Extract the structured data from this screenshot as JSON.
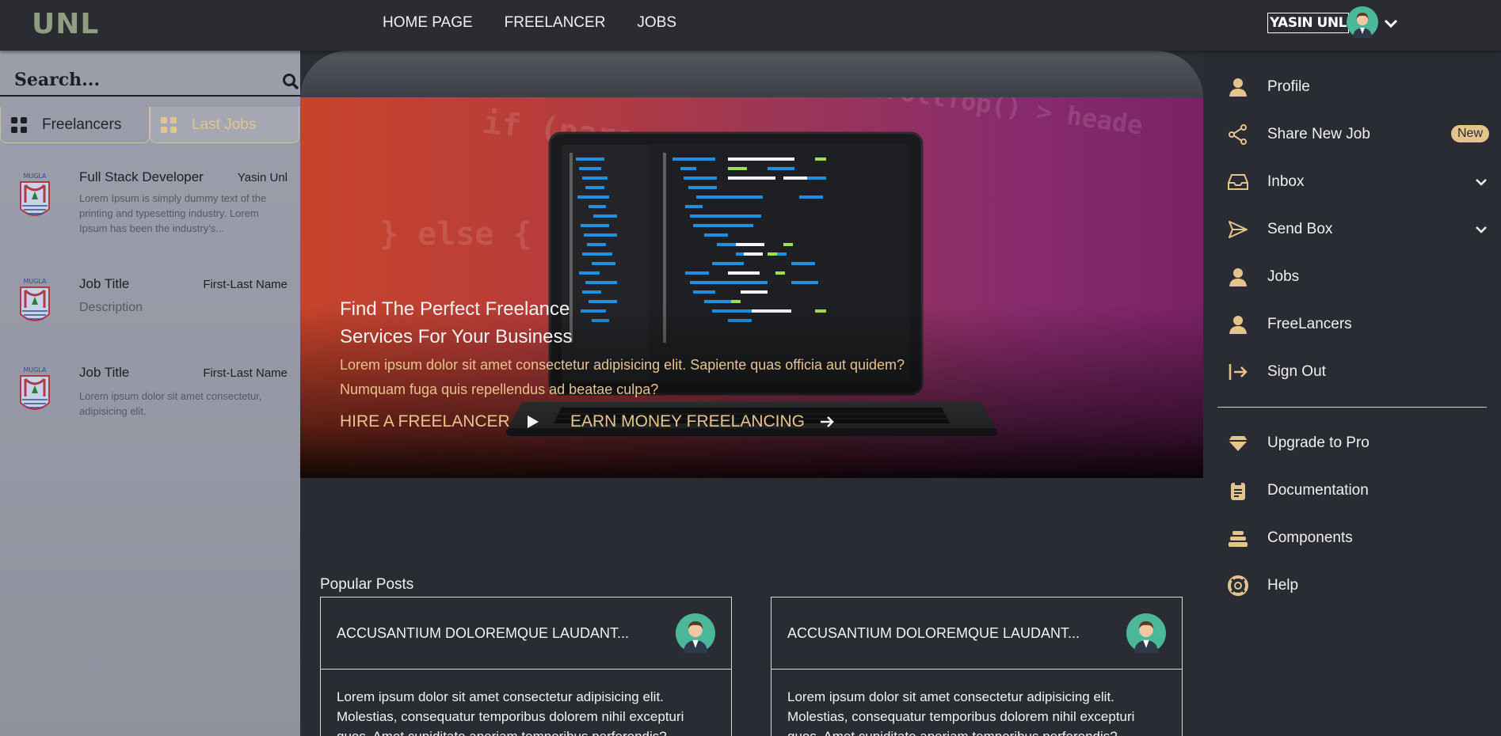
{
  "brand": "UNL",
  "nav": [
    "HOME PAGE",
    "FREELANCER",
    "JOBS"
  ],
  "user": {
    "name": "YASIN UNL"
  },
  "search": {
    "placeholder": "Search..."
  },
  "left_tabs": {
    "freelancers": "Freelancers",
    "last_jobs": "Last Jobs"
  },
  "posts": [
    {
      "title": "Full Stack Developer",
      "author": "Yasin Unl",
      "description": "Lorem Ipsum is simply dummy text of the printing and typesetting industry. Lorem Ipsum has been the industry's..."
    },
    {
      "title": "Job Title",
      "author": "First-Last Name",
      "description": "Description"
    },
    {
      "title": "Job Title",
      "author": "First-Last Name",
      "description": "Lorem ipsum dolor sit amet consectetur, adipisicing elit."
    }
  ],
  "logo_text": "MUGLA",
  "hero": {
    "heading": "Find The Perfect Freelance Services For Your Business",
    "text": "Lorem ipsum dolor sit amet consectetur adipisicing elit. Sapiente quas officia aut quidem? Numquam fuga quis repellendus ad beatae culpa?",
    "cta_hire": "HIRE A FREELANCER",
    "cta_earn": "EARN MONEY FREELANCING"
  },
  "popular_posts": {
    "title": "Popular Posts",
    "cards": [
      {
        "title": "ACCUSANTIUM DOLOREMQUE LAUDANT...",
        "body": "Lorem ipsum dolor sit amet consectetur adipisicing elit. Molestias, consequatur temporibus dolorem nihil excepturi quos. Amet cupiditate aperiam temporibus perferendis?"
      },
      {
        "title": "ACCUSANTIUM DOLOREMQUE LAUDANT...",
        "body": "Lorem ipsum dolor sit amet consectetur adipisicing elit. Molestias, consequatur temporibus dolorem nihil excepturi quos. Amet cupiditate aperiam temporibus perferendis?"
      }
    ]
  },
  "menu": {
    "profile": "Profile",
    "share_new_job": "Share New Job",
    "new_badge": "New",
    "inbox": "Inbox",
    "send_box": "Send Box",
    "jobs": "Jobs",
    "freelancers": "FreeLancers",
    "sign_out": "Sign Out",
    "upgrade": "Upgrade to Pro",
    "documentation": "Documentation",
    "components": "Components",
    "help": "Help"
  },
  "colors": {
    "accent": "#e5c38c",
    "brand": "#8f9d82",
    "background": "#2a2c33",
    "sidebar": "#9597a4"
  }
}
